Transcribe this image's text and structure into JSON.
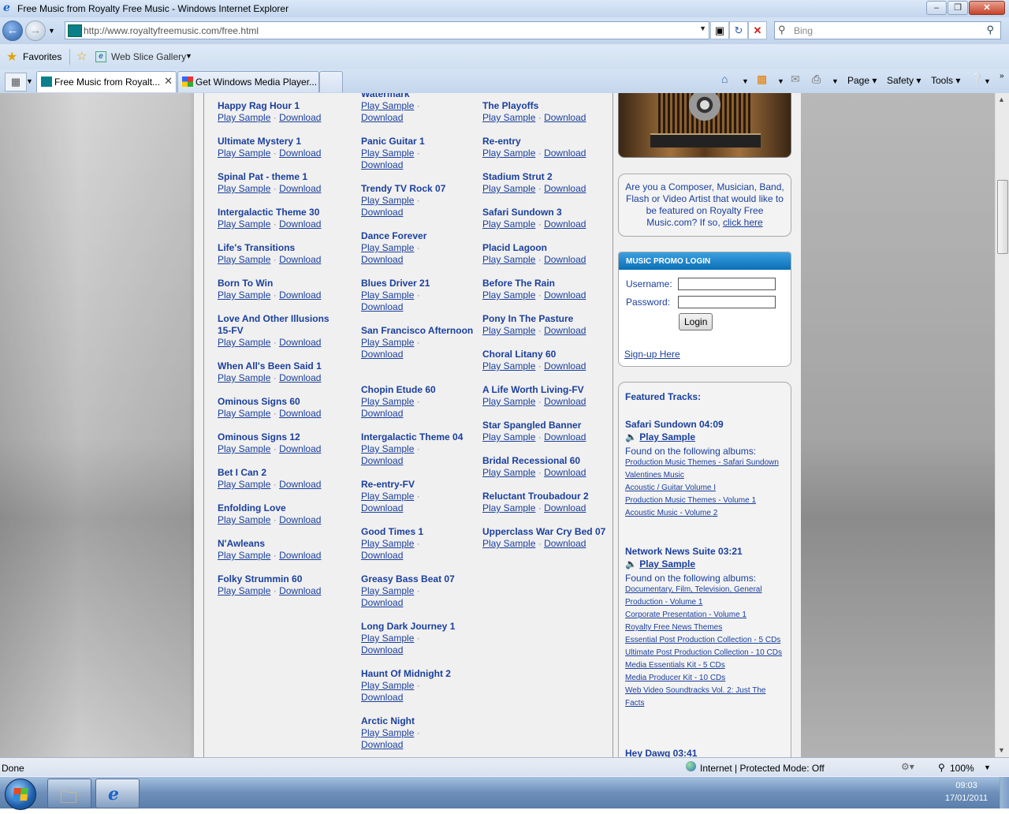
{
  "window": {
    "title": "Free Music from Royalty Free Music - Windows Internet Explorer"
  },
  "address": {
    "url": "http://www.royaltyfreemusic.com/free.html"
  },
  "search": {
    "placeholder": "Bing"
  },
  "favorites_bar": {
    "favorites_label": "Favorites",
    "web_slice_label": "Web Slice Gallery"
  },
  "tabs": [
    {
      "label": "Free Music from Royalt..."
    },
    {
      "label": "Get Windows Media Player..."
    }
  ],
  "commands": {
    "page": "Page",
    "safety": "Safety",
    "tools": "Tools"
  },
  "links": {
    "play": "Play Sample",
    "download": "Download",
    "sep": "·"
  },
  "col1": [
    "Happy Rag Hour 1",
    "Ultimate Mystery 1",
    "Spinal Pat - theme 1",
    "Intergalactic Theme 30",
    "Life's Transitions",
    "Born To Win",
    "Love And Other Illusions 15-FV",
    "When All's Been Said 1",
    "Ominous Signs 60",
    "Ominous Signs 12",
    "Bet I Can 2",
    "Enfolding Love",
    "N'Awleans",
    "Folky Strummin 60"
  ],
  "col2_top": "Watermark",
  "col2": [
    "Trendy TV Rock 07",
    "Dance Forever",
    "Blues Driver 21",
    "San Francisco Afternoon",
    "Chopin Etude 60",
    "Intergalactic Theme 04",
    "Re-entry-FV",
    "Good Times 1",
    "Greasy Bass Beat 07",
    "Long Dark Journey 1",
    "Haunt Of Midnight 2",
    "Arctic Night"
  ],
  "col2_mid": "Panic Guitar 1",
  "col3": [
    "The Playoffs",
    "Re-entry",
    "Stadium Strut 2",
    "Safari Sundown 3",
    "Placid Lagoon",
    "Before The Rain",
    "Pony In The Pasture",
    "Choral Litany 60",
    "A Life Worth Living-FV",
    "Star Spangled Banner",
    "Bridal Recessional 60",
    "Reluctant Troubadour 2",
    "Upperclass War Cry Bed 07"
  ],
  "composer": {
    "text": "Are you a Composer, Musician, Band, Flash or Video Artist that would like to be featured on Royalty Free Music.com? If so,",
    "link": "click here"
  },
  "login": {
    "header": "MUSIC PROMO LOGIN",
    "username_label": "Username:",
    "password_label": "Password:",
    "button": "Login",
    "signup": "Sign-up Here"
  },
  "featured": {
    "heading": "Featured Tracks:",
    "found_label": "Found on the following albums:",
    "tracks": [
      {
        "name": "Safari Sundown 04:09",
        "albums": [
          "Production Music Themes - Safari Sundown",
          "Valentines Music",
          "Acoustic / Guitar Volume I",
          "Production Music Themes - Volume 1",
          "Acoustic Music - Volume 2"
        ]
      },
      {
        "name": "Network News Suite 03:21",
        "albums": [
          "Documentary, Film, Television, General Production - Volume 1",
          "Corporate Presentation - Volume 1",
          "Royalty Free News Themes",
          "Essential Post Production Collection - 5 CDs",
          "Ultimate Post Production Collection - 10 CDs",
          "Media Essentials Kit - 5 CDs",
          "Media Producer Kit - 10 CDs",
          "Web Video Soundtracks Vol. 2: Just The Facts"
        ]
      },
      {
        "name": "Hey Dawg 03:41",
        "albums": []
      }
    ]
  },
  "status": {
    "left": "Done",
    "zone": "Internet | Protected Mode: Off",
    "zoom": "100%"
  },
  "clock": {
    "time": "09:03",
    "date": "17/01/2011"
  }
}
